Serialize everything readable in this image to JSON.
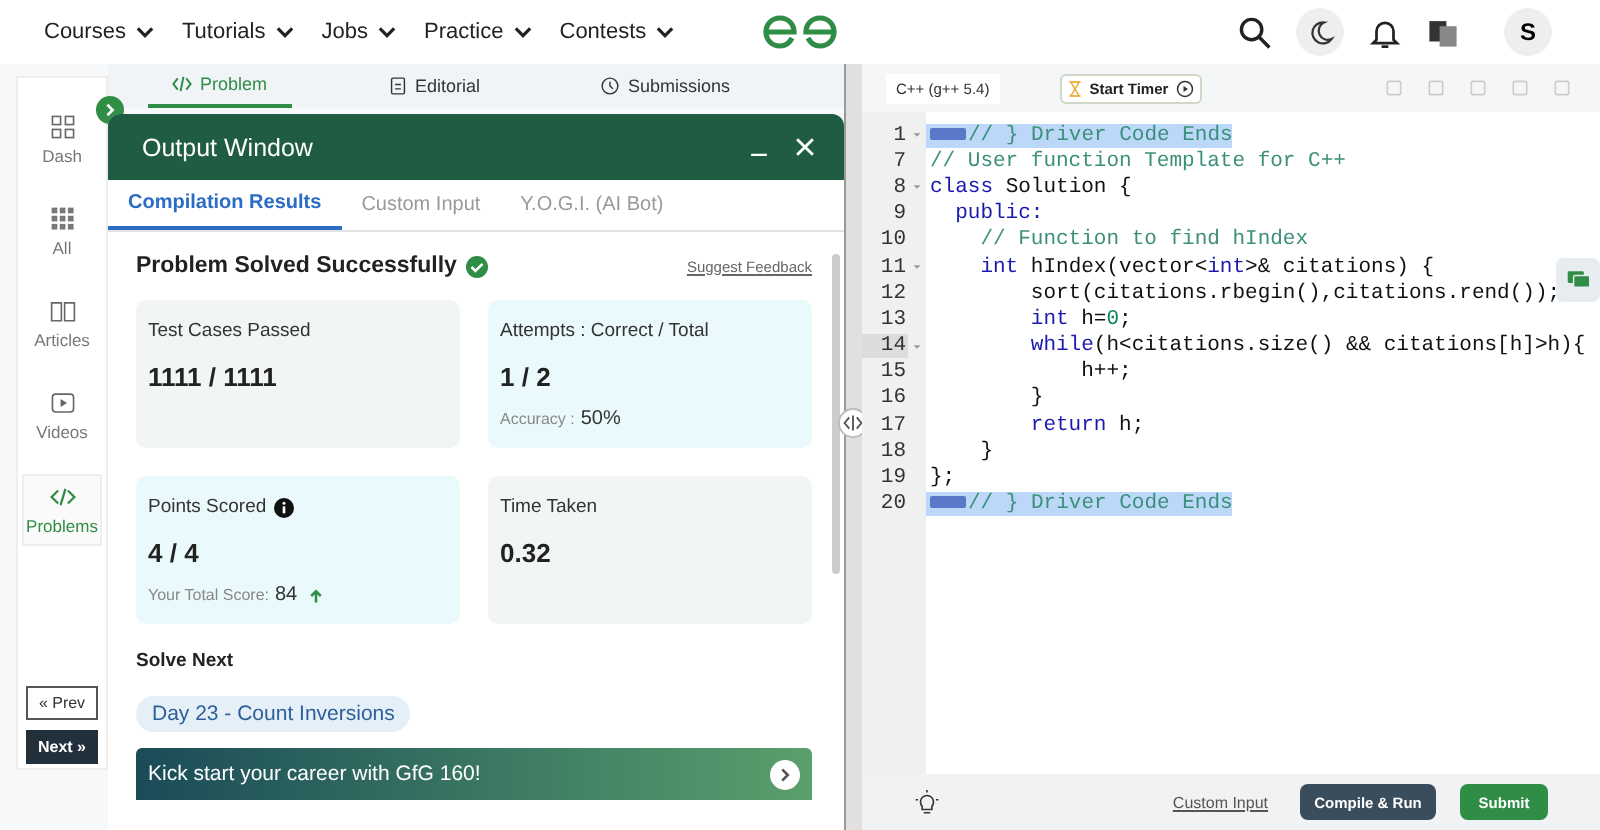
{
  "nav": {
    "menus": [
      {
        "label": "Courses"
      },
      {
        "label": "Tutorials"
      },
      {
        "label": "Jobs"
      },
      {
        "label": "Practice"
      },
      {
        "label": "Contests"
      }
    ],
    "avatar": "S"
  },
  "sidebar": {
    "items": [
      {
        "label": "Dash",
        "selected": false
      },
      {
        "label": "All",
        "selected": false
      },
      {
        "label": "Articles",
        "selected": false
      },
      {
        "label": "Videos",
        "selected": false
      },
      {
        "label": "Problems",
        "selected": true
      }
    ],
    "prev": "« Prev",
    "next": "Next »"
  },
  "problem_tabs": [
    {
      "label": "Problem",
      "selected": true
    },
    {
      "label": "Editorial",
      "selected": false
    },
    {
      "label": "Submissions",
      "selected": false
    }
  ],
  "output_window": {
    "title": "Output Window",
    "tabs": [
      {
        "label": "Compilation Results",
        "selected": true
      },
      {
        "label": "Custom Input",
        "selected": false
      },
      {
        "label": "Y.O.G.I. (AI Bot)",
        "selected": false
      }
    ],
    "status": "Problem Solved Successfully",
    "feedback": "Suggest Feedback",
    "cards": [
      {
        "title": "Test Cases Passed",
        "value": "1111 / 1111",
        "color": "#f2f5f5"
      },
      {
        "title": "Attempts : Correct / Total",
        "value": "1 / 2",
        "color": "#eaf9fc",
        "note_label": "Accuracy :",
        "note_value": "50%"
      },
      {
        "title": "Points Scored",
        "value": "4 / 4",
        "color": "#eaf9fc",
        "info": true,
        "note_label": "Your Total Score:",
        "note_value": "84",
        "trend_up": true
      },
      {
        "title": "Time Taken",
        "value": "0.32",
        "color": "#f2f5f5"
      }
    ],
    "solve_next_heading": "Solve Next",
    "solve_next": "Day 23 - Count Inversions",
    "banner": "Kick start your career with GfG 160!"
  },
  "editor": {
    "language": "C++ (g++ 5.4)",
    "timer": "Start Timer",
    "lines": [
      {
        "number": "1",
        "foldable": true,
        "folded": true,
        "highlighted": true,
        "active": false,
        "segments": [
          {
            "kind": "comment",
            "text": "// } Driver Code Ends"
          }
        ]
      },
      {
        "number": "7",
        "foldable": false,
        "folded": false,
        "highlighted": false,
        "active": false,
        "segments": [
          {
            "kind": "comment",
            "text": "// User function Template for C++"
          }
        ]
      },
      {
        "number": "8",
        "foldable": true,
        "folded": false,
        "highlighted": false,
        "active": false,
        "segments": [
          {
            "kind": "keyword",
            "text": "class"
          },
          {
            "kind": "plain",
            "text": " Solution {"
          }
        ]
      },
      {
        "number": "9",
        "foldable": false,
        "folded": false,
        "highlighted": false,
        "active": false,
        "segments": [
          {
            "kind": "keyword",
            "text": "  public:"
          }
        ]
      },
      {
        "number": "10",
        "foldable": false,
        "folded": false,
        "highlighted": false,
        "active": false,
        "segments": [
          {
            "kind": "comment",
            "text": "    // Function to find hIndex"
          }
        ]
      },
      {
        "number": "11",
        "foldable": true,
        "folded": false,
        "highlighted": false,
        "active": false,
        "segments": [
          {
            "kind": "keyword",
            "text": "    int"
          },
          {
            "kind": "plain",
            "text": " hIndex(vector<"
          },
          {
            "kind": "keyword",
            "text": "int"
          },
          {
            "kind": "plain",
            "text": ">& citations) {"
          }
        ]
      },
      {
        "number": "12",
        "foldable": false,
        "folded": false,
        "highlighted": false,
        "active": false,
        "segments": [
          {
            "kind": "plain",
            "text": "        sort(citations.rbegin(),citations.rend());"
          }
        ]
      },
      {
        "number": "13",
        "foldable": false,
        "folded": false,
        "highlighted": false,
        "active": false,
        "segments": [
          {
            "kind": "keyword",
            "text": "        int"
          },
          {
            "kind": "plain",
            "text": " h="
          },
          {
            "kind": "number",
            "text": "0"
          },
          {
            "kind": "plain",
            "text": ";"
          }
        ]
      },
      {
        "number": "14",
        "foldable": true,
        "folded": false,
        "highlighted": false,
        "active": true,
        "segments": [
          {
            "kind": "keyword",
            "text": "        while"
          },
          {
            "kind": "plain",
            "text": "(h<citations.size() && citations[h]>h){"
          }
        ]
      },
      {
        "number": "15",
        "foldable": false,
        "folded": false,
        "highlighted": false,
        "active": false,
        "segments": [
          {
            "kind": "plain",
            "text": "            h++;"
          }
        ]
      },
      {
        "number": "16",
        "foldable": false,
        "folded": false,
        "highlighted": false,
        "active": false,
        "segments": [
          {
            "kind": "plain",
            "text": "        }"
          }
        ]
      },
      {
        "number": "17",
        "foldable": false,
        "folded": false,
        "highlighted": false,
        "active": false,
        "segments": [
          {
            "kind": "keyword",
            "text": "        return"
          },
          {
            "kind": "plain",
            "text": " h;"
          }
        ]
      },
      {
        "number": "18",
        "foldable": false,
        "folded": false,
        "highlighted": false,
        "active": false,
        "segments": [
          {
            "kind": "plain",
            "text": "    }"
          }
        ]
      },
      {
        "number": "19",
        "foldable": false,
        "folded": false,
        "highlighted": false,
        "active": false,
        "segments": [
          {
            "kind": "plain",
            "text": "};"
          }
        ]
      },
      {
        "number": "20",
        "foldable": false,
        "folded": true,
        "highlighted": true,
        "active": false,
        "segments": [
          {
            "kind": "comment",
            "text": "// } Driver Code Ends"
          }
        ]
      }
    ],
    "custom_input": "Custom Input",
    "compile": "Compile & Run",
    "submit": "Submit"
  }
}
